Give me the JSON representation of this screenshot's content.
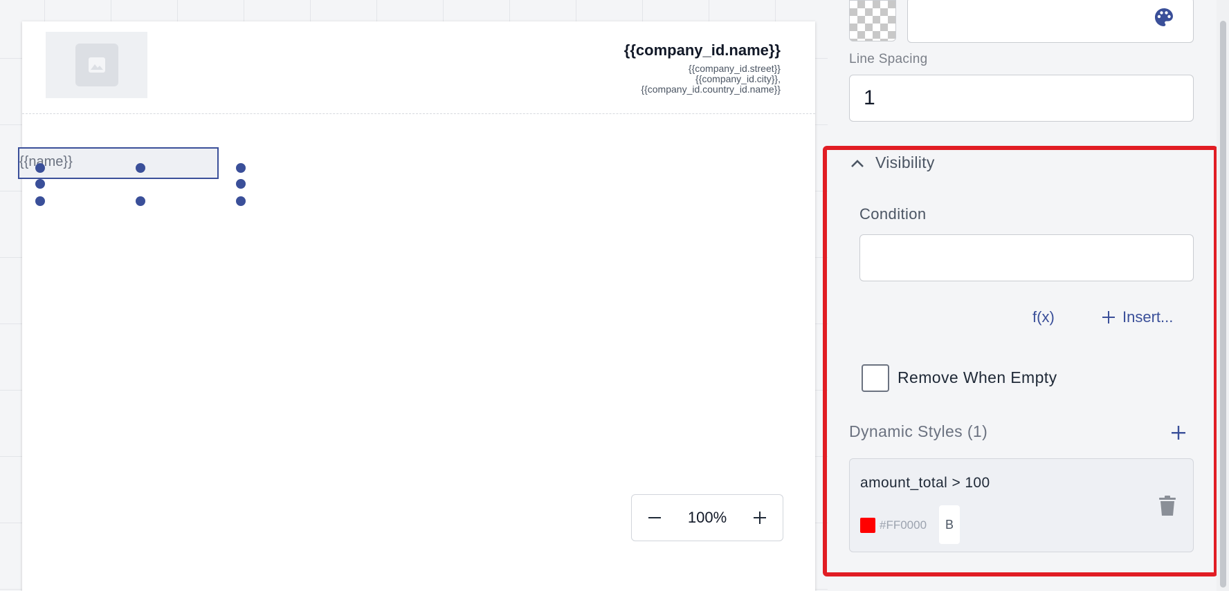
{
  "canvas": {
    "company": {
      "name": "{{company_id.name}}",
      "street": "{{company_id.street}}",
      "city": "{{company_id.city}},",
      "country": "{{company_id.country_id.name}}"
    },
    "field_text": "{{name}}",
    "zoom": {
      "value": "100%"
    }
  },
  "panel": {
    "line_spacing": {
      "label": "Line Spacing",
      "value": "1"
    },
    "visibility": {
      "title": "Visibility",
      "condition_label": "Condition",
      "condition_value": "",
      "fx_label": "f(x)",
      "insert_label": "Insert...",
      "remove_when_empty": "Remove When Empty"
    },
    "dynamic_styles": {
      "title": "Dynamic Styles (1)",
      "items": [
        {
          "condition": "amount_total > 100",
          "color": "#FF0000",
          "hex_label": "#FF0000",
          "bold_label": "B"
        }
      ]
    }
  },
  "colors": {
    "accent": "#3a4f99",
    "highlight": "#e11d24"
  }
}
